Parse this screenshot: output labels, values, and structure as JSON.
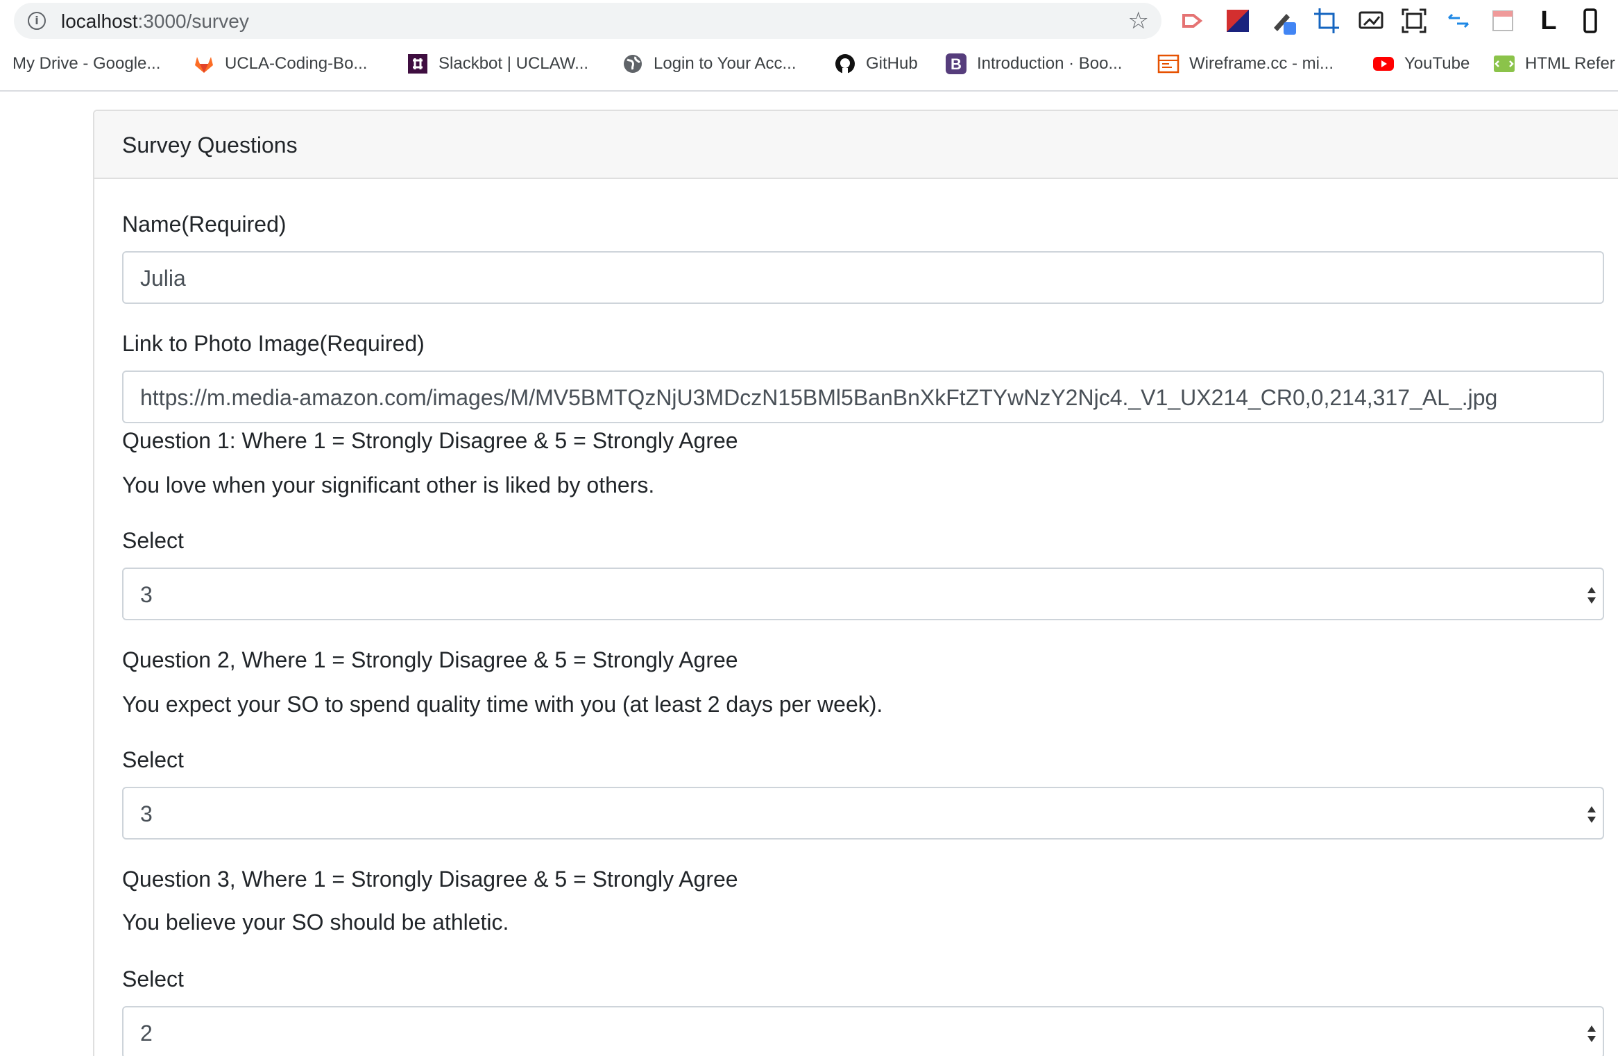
{
  "browser": {
    "url_host": "localhost",
    "url_path": ":3000/survey",
    "bookmarks": [
      {
        "label": "My Drive - Google...",
        "icon": "drive-icon"
      },
      {
        "label": "UCLA-Coding-Bo...",
        "icon": "gitlab-icon"
      },
      {
        "label": "Slackbot | UCLAW...",
        "icon": "slack-icon"
      },
      {
        "label": "Login to Your Acc...",
        "icon": "globe-icon"
      },
      {
        "label": "GitHub",
        "icon": "github-icon"
      },
      {
        "label": "Introduction · Boo...",
        "icon": "bootstrap-icon"
      },
      {
        "label": "Wireframe.cc - mi...",
        "icon": "wireframe-icon"
      },
      {
        "label": "YouTube",
        "icon": "youtube-icon"
      },
      {
        "label": "HTML Refer",
        "icon": "html-ref-icon"
      }
    ],
    "extension_letter": "L"
  },
  "survey": {
    "header": "Survey Questions",
    "name_label": "Name(Required)",
    "name_value": "Julia",
    "photo_label": "Link to Photo Image(Required)",
    "photo_value": "https://m.media-amazon.com/images/M/MV5BMTQzNjU3MDczN15BMl5BanBnXkFtZTYwNzY2Njc4._V1_UX214_CR0,0,214,317_AL_.jpg",
    "questions": [
      {
        "heading": "Question 1: Where 1 = Strongly Disagree & 5 = Strongly Agree",
        "text": "You love when your significant other is liked by others.",
        "select_label": "Select",
        "value": "3"
      },
      {
        "heading": "Question 2, Where 1 = Strongly Disagree & 5 = Strongly Agree",
        "text": "You expect your SO to spend quality time with you (at least 2 days per week).",
        "select_label": "Select",
        "value": "3"
      },
      {
        "heading": "Question 3, Where 1 = Strongly Disagree & 5 = Strongly Agree",
        "text": "You believe your SO should be athletic.",
        "select_label": "Select",
        "value": "2"
      }
    ]
  }
}
